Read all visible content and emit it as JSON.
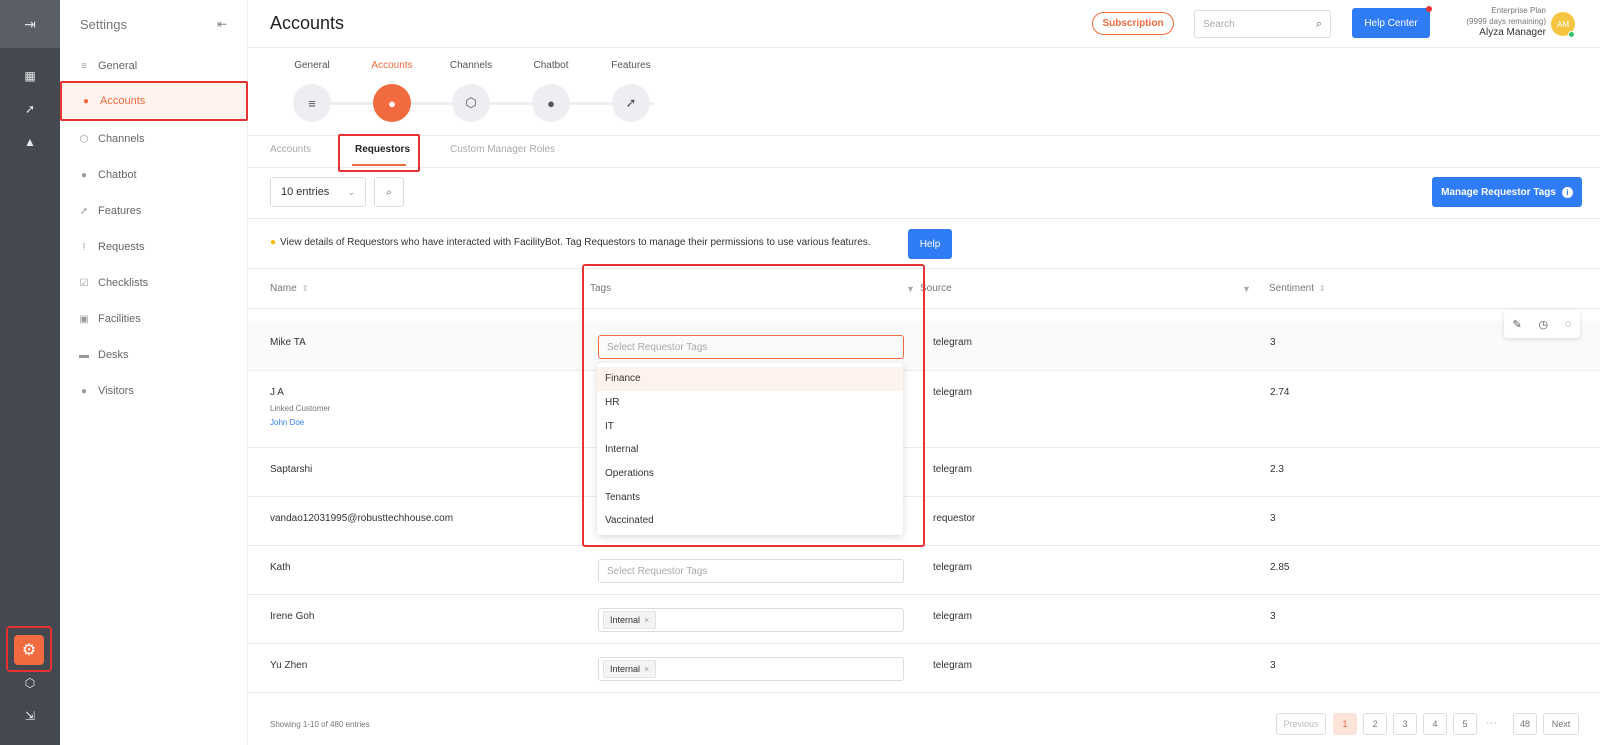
{
  "settings_title": "Settings",
  "sidebar": {
    "items": [
      {
        "label": "General",
        "icon": "sliders-icon"
      },
      {
        "label": "Accounts",
        "icon": "users-icon"
      },
      {
        "label": "Channels",
        "icon": "cube-icon"
      },
      {
        "label": "Chatbot",
        "icon": "chat-icon"
      },
      {
        "label": "Features",
        "icon": "rocket-icon"
      },
      {
        "label": "Requests",
        "icon": "exclamation-icon"
      },
      {
        "label": "Checklists",
        "icon": "checklist-icon"
      },
      {
        "label": "Facilities",
        "icon": "calendar-icon"
      },
      {
        "label": "Desks",
        "icon": "desk-icon"
      },
      {
        "label": "Visitors",
        "icon": "visitor-icon"
      }
    ]
  },
  "header": {
    "title": "Accounts",
    "subscription": "Subscription",
    "search_placeholder": "Search",
    "help_center": "Help Center",
    "plan_line1": "Enterprise Plan",
    "plan_line2": "(9999 days remaining)",
    "user_name": "Alyza Manager",
    "avatar_initials": "AM"
  },
  "steps": [
    {
      "label": "General"
    },
    {
      "label": "Accounts"
    },
    {
      "label": "Channels"
    },
    {
      "label": "Chatbot"
    },
    {
      "label": "Features"
    }
  ],
  "subtabs": [
    "Accounts",
    "Requestors",
    "Custom Manager Roles"
  ],
  "toolbar": {
    "entries": "10 entries",
    "manage_tags": "Manage Requestor Tags"
  },
  "notice": {
    "text": "View details of Requestors who have interacted with FacilityBot. Tag Requestors to manage their permissions to use various features.",
    "help": "Help"
  },
  "columns": {
    "name": "Name",
    "tags": "Tags",
    "source": "Source",
    "sentiment": "Sentiment"
  },
  "tag_placeholder": "Select Requestor Tags",
  "rows": [
    {
      "name": "Mike TA",
      "source": "telegram",
      "sentiment": "3"
    },
    {
      "name": "J A",
      "linked_label": "Linked Customer",
      "linked_name": "John Doe",
      "source": "telegram",
      "sentiment": "2.74"
    },
    {
      "name": "Saptarshi",
      "source": "telegram",
      "sentiment": "2.3"
    },
    {
      "name": "vandao12031995@robusttechhouse.com",
      "source": "requestor",
      "sentiment": "3"
    },
    {
      "name": "Kath",
      "source": "telegram",
      "sentiment": "2.85"
    },
    {
      "name": "Irene Goh",
      "tag": "Internal",
      "source": "telegram",
      "sentiment": "3"
    },
    {
      "name": "Yu Zhen",
      "tag": "Internal",
      "source": "telegram",
      "sentiment": "3"
    }
  ],
  "dropdown_options": [
    "Finance",
    "HR",
    "IT",
    "Internal",
    "Operations",
    "Tenants",
    "Vaccinated"
  ],
  "footer": {
    "showing": "Showing 1-10 of 480 entries",
    "previous": "Previous",
    "pages": [
      "1",
      "2",
      "3",
      "4",
      "5"
    ],
    "ellipsis": "···",
    "last": "48",
    "next": "Next"
  },
  "colors": {
    "accent": "#f26a3f",
    "primary": "#2f7cf6",
    "highlight_border": "#e63232"
  }
}
